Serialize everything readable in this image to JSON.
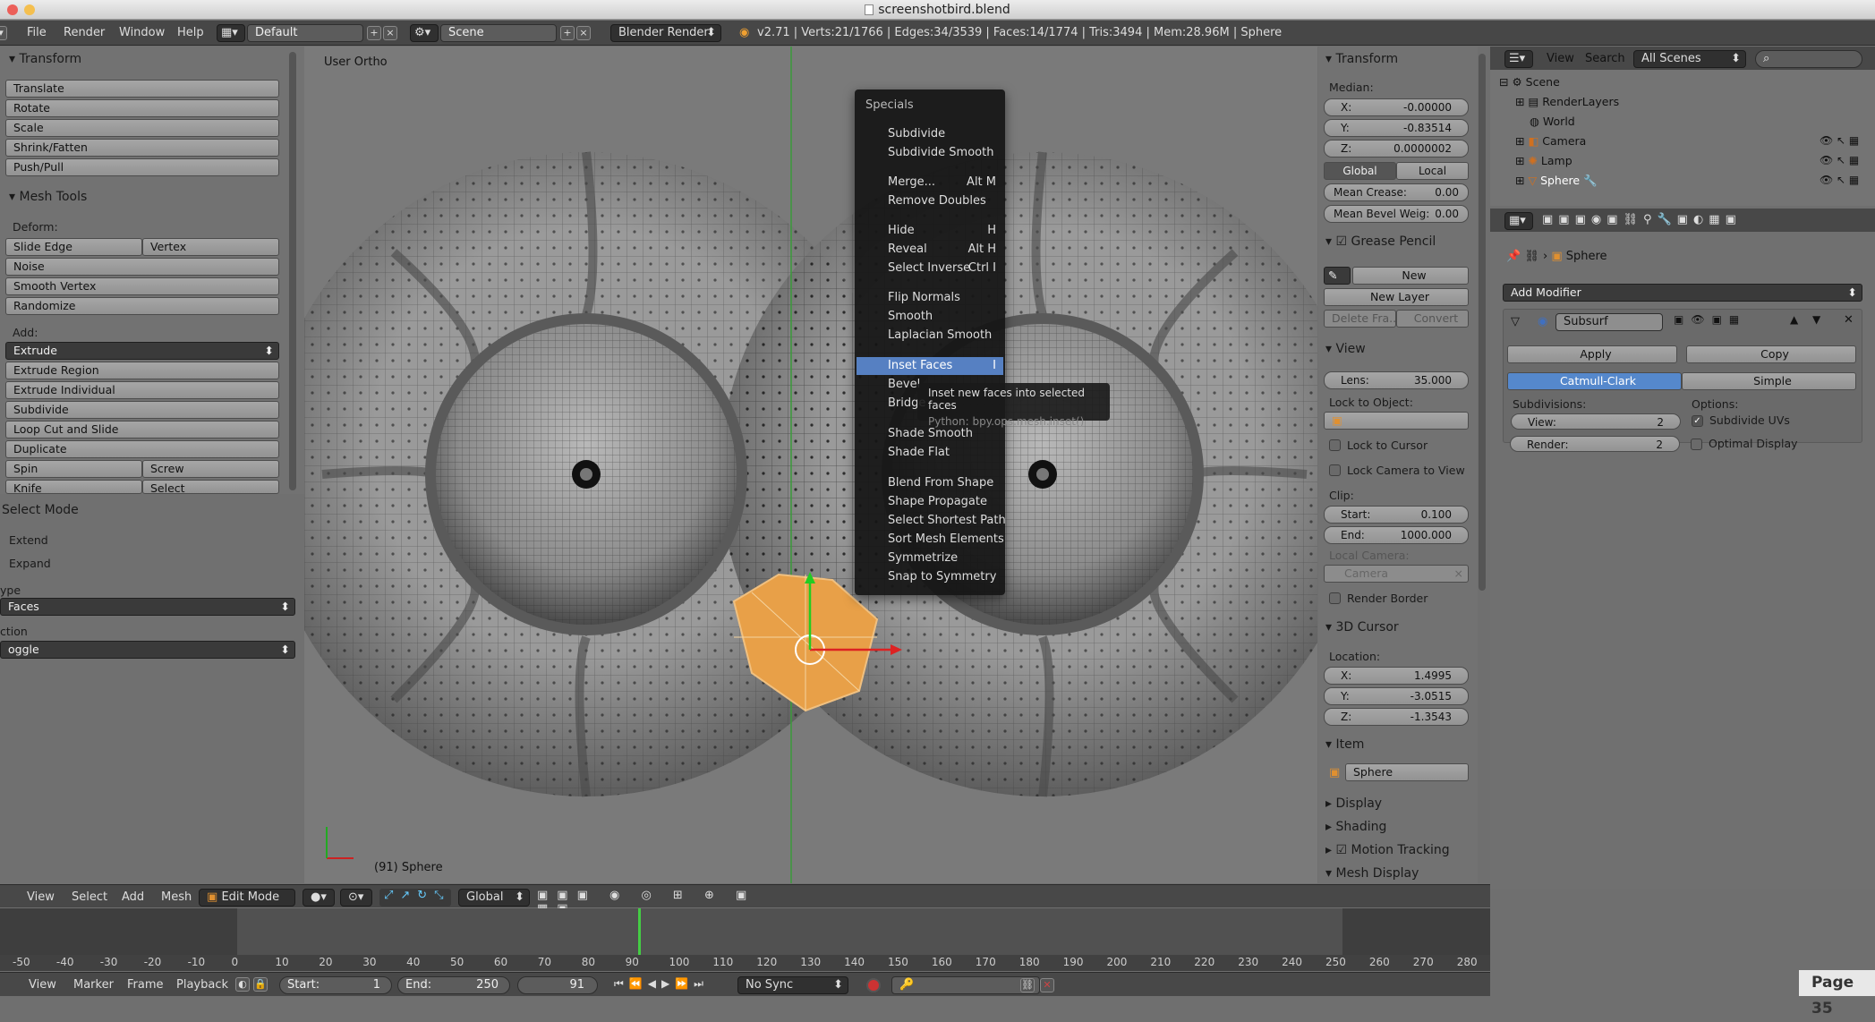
{
  "window": {
    "title": "screenshotbird.blend"
  },
  "infobar": {
    "menus": [
      "File",
      "Render",
      "Window",
      "Help"
    ],
    "layout": "Default",
    "scene": "Scene",
    "engine": "Blender Render",
    "stats": "v2.71 | Verts:21/1766 | Edges:34/3539 | Faces:14/1774 | Tris:3494 | Mem:28.96M | Sphere"
  },
  "toolshelf": {
    "transform": {
      "title": "Transform",
      "buttons": [
        "Translate",
        "Rotate",
        "Scale",
        "Shrink/Fatten",
        "Push/Pull"
      ]
    },
    "meshtools": {
      "title": "Mesh Tools",
      "deform": "Deform:",
      "slide_edge": "Slide Edge",
      "vertex": "Vertex",
      "noise": "Noise",
      "smooth_vertex": "Smooth Vertex",
      "randomize": "Randomize",
      "add": "Add:",
      "extrude": "Extrude",
      "extrude_region": "Extrude Region",
      "extrude_individual": "Extrude Individual",
      "subdivide": "Subdivide",
      "loop_cut": "Loop Cut and Slide",
      "duplicate": "Duplicate",
      "spin": "Spin",
      "screw": "Screw",
      "knife": "Knife",
      "select": "Select"
    }
  },
  "operator": {
    "title": "Select Mode",
    "extend": "Extend",
    "expand": "Expand",
    "type_label": "ype",
    "type_value": "Faces",
    "action_label": "ction",
    "action_value": "oggle"
  },
  "viewport": {
    "view_name": "User Ortho",
    "object_label": "(91) Sphere"
  },
  "specials": {
    "title": "Specials",
    "items": [
      {
        "label": "Subdivide",
        "shortcut": ""
      },
      {
        "label": "Subdivide Smooth",
        "shortcut": ""
      },
      {
        "label": "Merge...",
        "shortcut": "Alt M"
      },
      {
        "label": "Remove Doubles",
        "shortcut": ""
      },
      {
        "label": "Hide",
        "shortcut": "H"
      },
      {
        "label": "Reveal",
        "shortcut": "Alt H"
      },
      {
        "label": "Select Inverse",
        "shortcut": "Ctrl I"
      },
      {
        "label": "Flip Normals",
        "shortcut": ""
      },
      {
        "label": "Smooth",
        "shortcut": ""
      },
      {
        "label": "Laplacian Smooth",
        "shortcut": ""
      },
      {
        "label": "Inset Faces",
        "shortcut": "I"
      },
      {
        "label": "Bevel",
        "shortcut": ""
      },
      {
        "label": "Bridge",
        "shortcut": ""
      },
      {
        "label": "Shade Smooth",
        "shortcut": ""
      },
      {
        "label": "Shade Flat",
        "shortcut": ""
      },
      {
        "label": "Blend From Shape",
        "shortcut": ""
      },
      {
        "label": "Shape Propagate",
        "shortcut": ""
      },
      {
        "label": "Select Shortest Path",
        "shortcut": ""
      },
      {
        "label": "Sort Mesh Elements",
        "shortcut": ""
      },
      {
        "label": "Symmetrize",
        "shortcut": ""
      },
      {
        "label": "Snap to Symmetry",
        "shortcut": ""
      }
    ],
    "tooltip": "Inset new faces into selected faces",
    "tooltip_python": "Python: bpy.ops.mesh.inset()"
  },
  "npanel": {
    "transform": "Transform",
    "median": "Median:",
    "x_label": "X:",
    "x": "-0.00000",
    "y_label": "Y:",
    "y": "-0.83514",
    "z_label": "Z:",
    "z": "0.0000002",
    "global": "Global",
    "local": "Local",
    "mean_crease_label": "Mean Crease:",
    "mean_crease": "0.00",
    "mean_bevel_label": "Mean Bevel Weig:",
    "mean_bevel": "0.00",
    "grease_pencil": "Grease Pencil",
    "new": "New",
    "new_layer": "New Layer",
    "delete_frame": "Delete Fra...",
    "convert": "Convert",
    "view": "View",
    "lens_label": "Lens:",
    "lens": "35.000",
    "lock_to_object": "Lock to Object:",
    "lock_to_cursor": "Lock to Cursor",
    "lock_camera": "Lock Camera to View",
    "clip": "Clip:",
    "start_label": "Start:",
    "start": "0.100",
    "end_label": "End:",
    "end": "1000.000",
    "local_camera": "Local Camera:",
    "camera": "Camera",
    "render_border": "Render Border",
    "cursor": "3D Cursor",
    "location": "Location:",
    "cx": "1.4995",
    "cy": "-3.0515",
    "cz": "-1.3543",
    "item": "Item",
    "item_name": "Sphere",
    "display": "Display",
    "shading": "Shading",
    "motion_tracking": "Motion Tracking",
    "mesh_display": "Mesh Display"
  },
  "outliner": {
    "view": "View",
    "search": "Search",
    "all_scenes": "All Scenes",
    "items": [
      "Scene",
      "RenderLayers",
      "World",
      "Camera",
      "Lamp",
      "Sphere"
    ]
  },
  "properties": {
    "object": "Sphere",
    "add_modifier": "Add Modifier",
    "modifier_name": "Subsurf",
    "apply": "Apply",
    "copy": "Copy",
    "catmull": "Catmull-Clark",
    "simple": "Simple",
    "subdivisions": "Subdivisions:",
    "options": "Options:",
    "view_label": "View:",
    "view_value": "2",
    "render_label": "Render:",
    "render_value": "2",
    "subdivide_uvs": "Subdivide UVs",
    "optimal_display": "Optimal Display"
  },
  "view3d_header": {
    "view": "View",
    "select": "Select",
    "add": "Add",
    "mesh": "Mesh",
    "mode": "Edit Mode",
    "orientation": "Global"
  },
  "timeline": {
    "ticks": [
      "-50",
      "-40",
      "-30",
      "-20",
      "-10",
      "0",
      "10",
      "20",
      "30",
      "40",
      "50",
      "60",
      "70",
      "80",
      "90",
      "100",
      "110",
      "120",
      "130",
      "140",
      "150",
      "160",
      "170",
      "180",
      "190",
      "200",
      "210",
      "220",
      "230",
      "240",
      "250",
      "260",
      "270",
      "280"
    ],
    "current_frame": 91,
    "view": "View",
    "marker": "Marker",
    "frame": "Frame",
    "playback": "Playback",
    "start_label": "Start:",
    "start": "1",
    "end_label": "End:",
    "end": "250",
    "frame_value": "91",
    "sync": "No Sync"
  },
  "page": {
    "label": "Page 35"
  }
}
